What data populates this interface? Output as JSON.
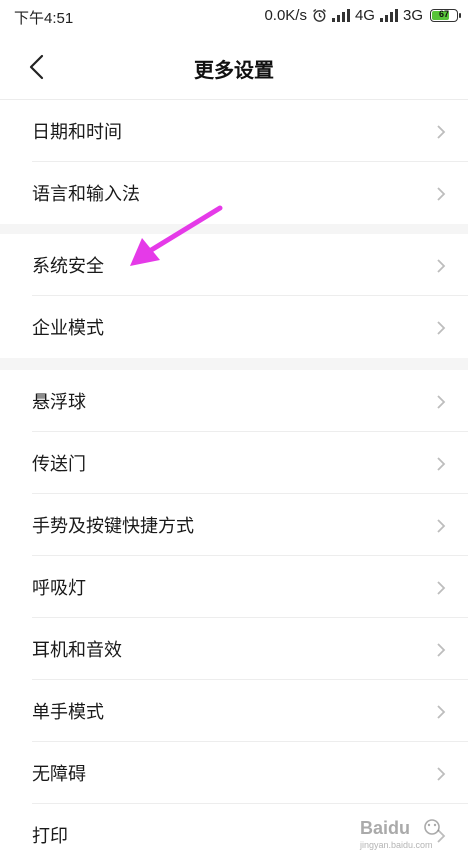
{
  "status_bar": {
    "time": "下午4:51",
    "speed": "0.0K/s",
    "network_1": "4G",
    "network_2": "3G",
    "battery": "67",
    "icons": [
      "alarm-icon",
      "signal-icon",
      "signal-icon",
      "battery-icon"
    ]
  },
  "header": {
    "title": "更多设置",
    "back_icon": "chevron-left-icon"
  },
  "groups": [
    {
      "items": [
        {
          "label": "日期和时间"
        },
        {
          "label": "语言和输入法"
        }
      ]
    },
    {
      "items": [
        {
          "label": "系统安全"
        },
        {
          "label": "企业模式"
        }
      ]
    },
    {
      "items": [
        {
          "label": "悬浮球"
        },
        {
          "label": "传送门"
        },
        {
          "label": "手势及按键快捷方式"
        },
        {
          "label": "呼吸灯"
        },
        {
          "label": "耳机和音效"
        },
        {
          "label": "单手模式"
        },
        {
          "label": "无障碍"
        },
        {
          "label": "打印"
        }
      ]
    }
  ],
  "annotation": {
    "arrow_color": "#e53ae8",
    "points_to": "系统安全"
  },
  "watermark": {
    "brand": "Baidu",
    "sub": "jingyan.baidu.com"
  },
  "colors": {
    "battery": "#58c43a",
    "arrow": "#e53ae8"
  }
}
